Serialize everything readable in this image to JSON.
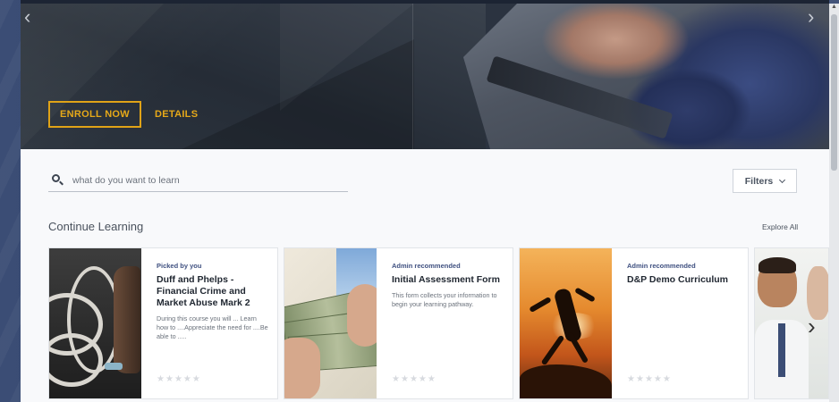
{
  "hero": {
    "enroll_label": "ENROLL NOW",
    "details_label": "DETAILS",
    "accent_color": "#e6a919"
  },
  "search": {
    "placeholder": "what do you want to learn",
    "value": ""
  },
  "filters": {
    "label": "Filters"
  },
  "section": {
    "title": "Continue Learning",
    "explore_label": "Explore All"
  },
  "cards": [
    {
      "tag": "Picked by you",
      "title": "Duff and Phelps - Financial Crime and Market Abuse Mark 2",
      "description": "During this course you will ... Learn how to ....Appreciate the need for ....Be able to .....",
      "rating": 0,
      "rating_max": 5
    },
    {
      "tag": "Admin recommended",
      "title": "Initial Assessment Form",
      "description": "This form collects your information to begin your learning pathway.",
      "rating": 0,
      "rating_max": 5
    },
    {
      "tag": "Admin recommended",
      "title": "D&P Demo Curriculum",
      "description": "",
      "rating": 0,
      "rating_max": 5
    }
  ],
  "icons": {
    "hero_prev": "chevron-left-icon",
    "hero_next": "chevron-right-icon",
    "search": "search-icon",
    "filters": "chevron-down-icon",
    "carousel_next": "chevron-right-icon",
    "star": "star-icon"
  },
  "colors": {
    "tag": "#3f5080",
    "backdrop": "#3b4d75"
  }
}
